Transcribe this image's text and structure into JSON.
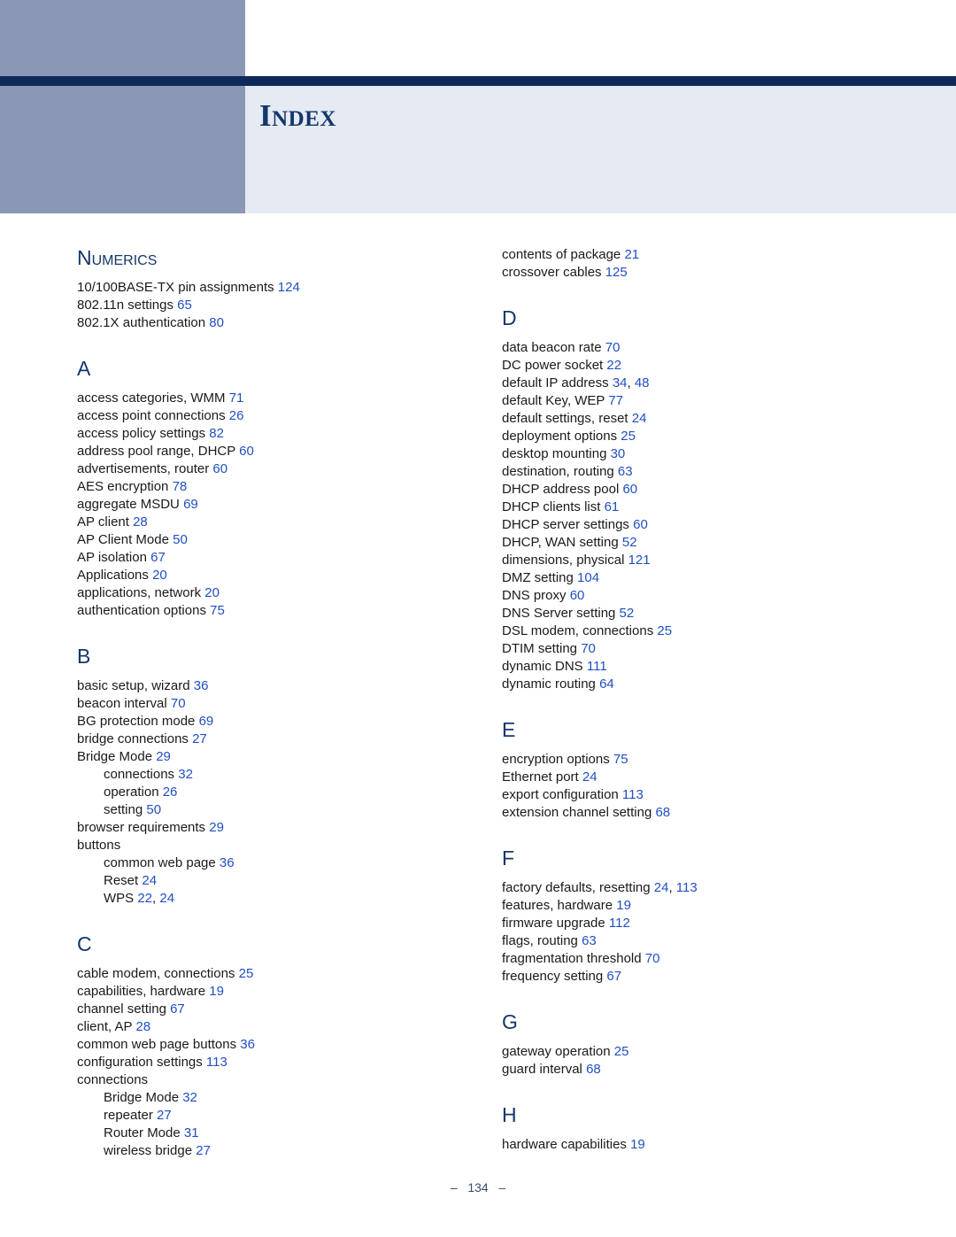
{
  "title": "Index",
  "page_number": "134",
  "footer_dash": "–",
  "sections_col1": [
    {
      "heading": "Numerics",
      "first": true,
      "entries": [
        {
          "text": "10/100BASE-TX pin assignments",
          "pages": [
            "124"
          ]
        },
        {
          "text": "802.11n settings",
          "pages": [
            "65"
          ]
        },
        {
          "text": "802.1X authentication",
          "pages": [
            "80"
          ]
        }
      ]
    },
    {
      "heading": "A",
      "entries": [
        {
          "text": "access categories, WMM",
          "pages": [
            "71"
          ]
        },
        {
          "text": "access point connections",
          "pages": [
            "26"
          ]
        },
        {
          "text": "access policy settings",
          "pages": [
            "82"
          ]
        },
        {
          "text": "address pool range, DHCP",
          "pages": [
            "60"
          ]
        },
        {
          "text": "advertisements, router",
          "pages": [
            "60"
          ]
        },
        {
          "text": "AES encryption",
          "pages": [
            "78"
          ]
        },
        {
          "text": "aggregate MSDU",
          "pages": [
            "69"
          ]
        },
        {
          "text": "AP client",
          "pages": [
            "28"
          ]
        },
        {
          "text": "AP Client Mode",
          "pages": [
            "50"
          ]
        },
        {
          "text": "AP isolation",
          "pages": [
            "67"
          ]
        },
        {
          "text": "Applications",
          "pages": [
            "20"
          ]
        },
        {
          "text": "applications, network",
          "pages": [
            "20"
          ]
        },
        {
          "text": "authentication options",
          "pages": [
            "75"
          ]
        }
      ]
    },
    {
      "heading": "B",
      "entries": [
        {
          "text": "basic setup, wizard",
          "pages": [
            "36"
          ]
        },
        {
          "text": "beacon interval",
          "pages": [
            "70"
          ]
        },
        {
          "text": "BG protection mode",
          "pages": [
            "69"
          ]
        },
        {
          "text": "bridge connections",
          "pages": [
            "27"
          ]
        },
        {
          "text": "Bridge Mode",
          "pages": [
            "29"
          ]
        },
        {
          "text": "connections",
          "pages": [
            "32"
          ],
          "sub": true
        },
        {
          "text": "operation",
          "pages": [
            "26"
          ],
          "sub": true
        },
        {
          "text": "setting",
          "pages": [
            "50"
          ],
          "sub": true
        },
        {
          "text": "browser requirements",
          "pages": [
            "29"
          ]
        },
        {
          "text": "buttons",
          "subhead": true
        },
        {
          "text": "common web page",
          "pages": [
            "36"
          ],
          "sub": true
        },
        {
          "text": "Reset",
          "pages": [
            "24"
          ],
          "sub": true
        },
        {
          "text": "WPS",
          "pages": [
            "22",
            "24"
          ],
          "sub": true
        }
      ]
    },
    {
      "heading": "C",
      "entries": [
        {
          "text": "cable modem, connections",
          "pages": [
            "25"
          ]
        },
        {
          "text": "capabilities, hardware",
          "pages": [
            "19"
          ]
        },
        {
          "text": "channel setting",
          "pages": [
            "67"
          ]
        },
        {
          "text": "client, AP",
          "pages": [
            "28"
          ]
        },
        {
          "text": "common web page buttons",
          "pages": [
            "36"
          ]
        },
        {
          "text": "configuration settings",
          "pages": [
            "113"
          ]
        },
        {
          "text": "connections",
          "subhead": true
        },
        {
          "text": "Bridge Mode",
          "pages": [
            "32"
          ],
          "sub": true
        },
        {
          "text": "repeater",
          "pages": [
            "27"
          ],
          "sub": true
        },
        {
          "text": "Router Mode",
          "pages": [
            "31"
          ],
          "sub": true
        },
        {
          "text": "wireless bridge",
          "pages": [
            "27"
          ],
          "sub": true
        }
      ]
    }
  ],
  "sections_col2": [
    {
      "heading": null,
      "first": true,
      "entries": [
        {
          "text": "contents of package",
          "pages": [
            "21"
          ]
        },
        {
          "text": "crossover cables",
          "pages": [
            "125"
          ]
        }
      ]
    },
    {
      "heading": "D",
      "entries": [
        {
          "text": "data beacon rate",
          "pages": [
            "70"
          ]
        },
        {
          "text": "DC power socket",
          "pages": [
            "22"
          ]
        },
        {
          "text": "default IP address",
          "pages": [
            "34",
            "48"
          ]
        },
        {
          "text": "default Key, WEP",
          "pages": [
            "77"
          ]
        },
        {
          "text": "default settings, reset",
          "pages": [
            "24"
          ]
        },
        {
          "text": "deployment options",
          "pages": [
            "25"
          ]
        },
        {
          "text": "desktop mounting",
          "pages": [
            "30"
          ]
        },
        {
          "text": "destination, routing",
          "pages": [
            "63"
          ]
        },
        {
          "text": "DHCP address pool",
          "pages": [
            "60"
          ]
        },
        {
          "text": "DHCP clients list",
          "pages": [
            "61"
          ]
        },
        {
          "text": "DHCP server settings",
          "pages": [
            "60"
          ]
        },
        {
          "text": "DHCP, WAN setting",
          "pages": [
            "52"
          ]
        },
        {
          "text": "dimensions, physical",
          "pages": [
            "121"
          ]
        },
        {
          "text": "DMZ setting",
          "pages": [
            "104"
          ]
        },
        {
          "text": "DNS proxy",
          "pages": [
            "60"
          ]
        },
        {
          "text": "DNS Server setting",
          "pages": [
            "52"
          ]
        },
        {
          "text": "DSL modem, connections",
          "pages": [
            "25"
          ]
        },
        {
          "text": "DTIM setting",
          "pages": [
            "70"
          ]
        },
        {
          "text": "dynamic DNS",
          "pages": [
            "111"
          ]
        },
        {
          "text": "dynamic routing",
          "pages": [
            "64"
          ]
        }
      ]
    },
    {
      "heading": "E",
      "entries": [
        {
          "text": "encryption options",
          "pages": [
            "75"
          ]
        },
        {
          "text": "Ethernet port",
          "pages": [
            "24"
          ]
        },
        {
          "text": "export configuration",
          "pages": [
            "113"
          ]
        },
        {
          "text": "extension channel setting",
          "pages": [
            "68"
          ]
        }
      ]
    },
    {
      "heading": "F",
      "entries": [
        {
          "text": "factory defaults, resetting",
          "pages": [
            "24",
            "113"
          ]
        },
        {
          "text": "features, hardware",
          "pages": [
            "19"
          ]
        },
        {
          "text": "firmware upgrade",
          "pages": [
            "112"
          ]
        },
        {
          "text": "flags, routing",
          "pages": [
            "63"
          ]
        },
        {
          "text": "fragmentation threshold",
          "pages": [
            "70"
          ]
        },
        {
          "text": "frequency setting",
          "pages": [
            "67"
          ]
        }
      ]
    },
    {
      "heading": "G",
      "entries": [
        {
          "text": "gateway operation",
          "pages": [
            "25"
          ]
        },
        {
          "text": "guard interval",
          "pages": [
            "68"
          ]
        }
      ]
    },
    {
      "heading": "H",
      "entries": [
        {
          "text": "hardware capabilities",
          "pages": [
            "19"
          ]
        }
      ]
    }
  ]
}
